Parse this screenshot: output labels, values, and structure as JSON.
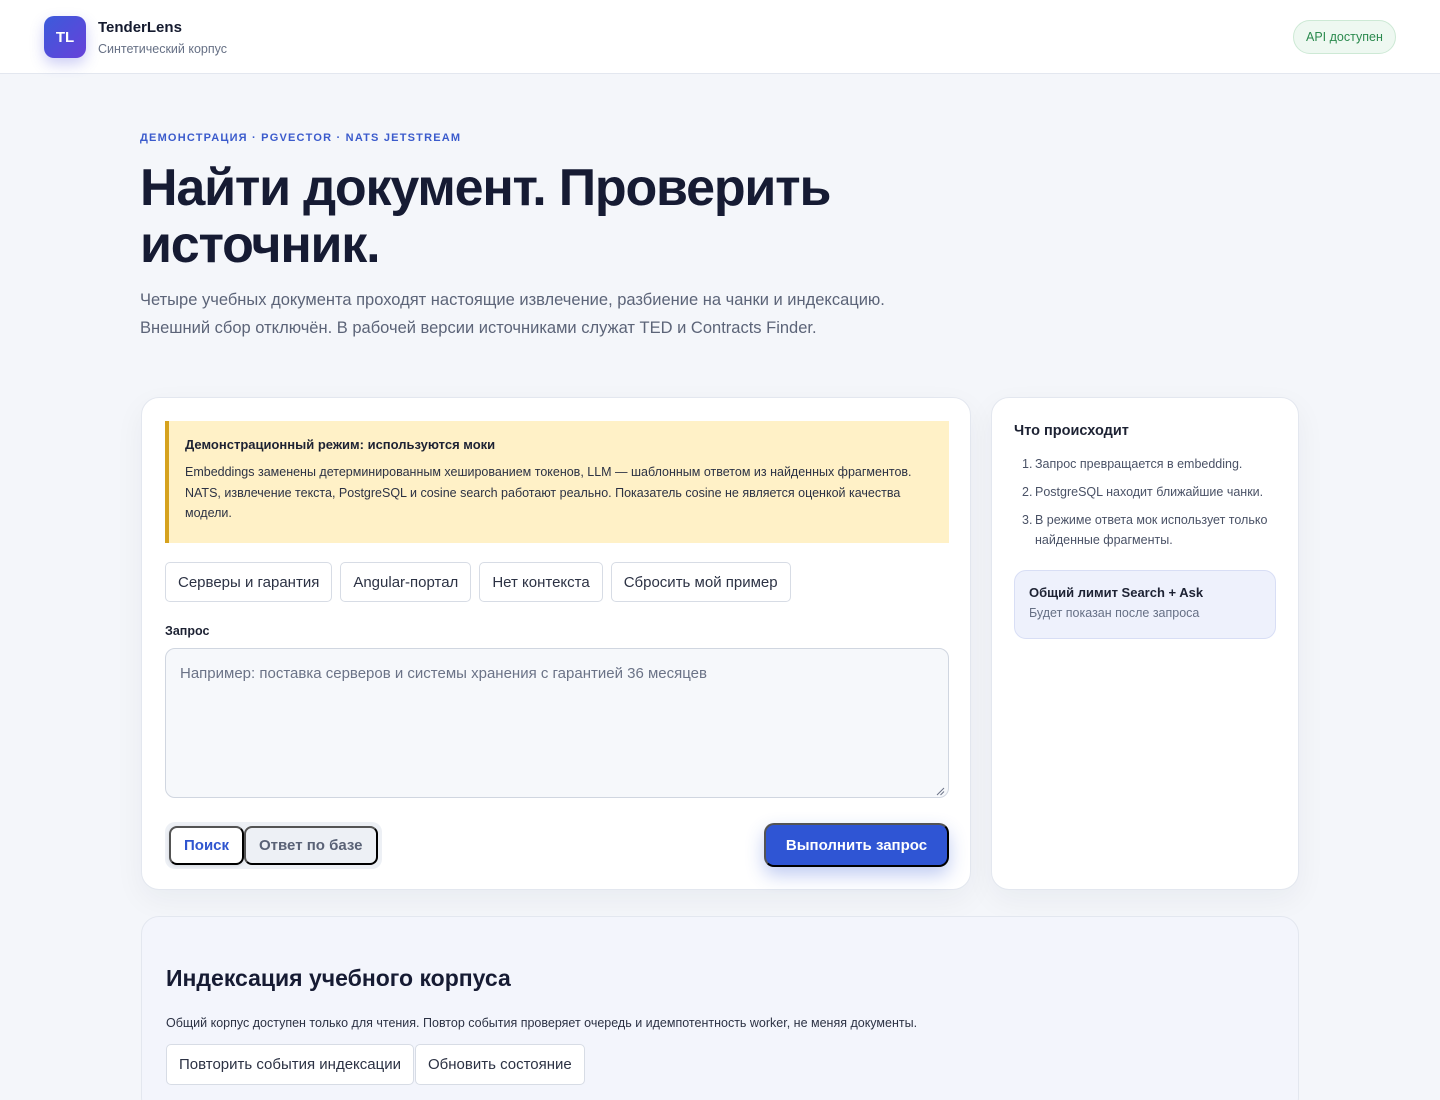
{
  "header": {
    "logo_text": "TL",
    "brand_name": "TenderLens",
    "brand_subtitle": "Синтетический корпус",
    "api_status": "API доступен",
    "api_status_color": "#2b8a4e"
  },
  "hero": {
    "eyebrow": "ДЕМОНСТРАЦИЯ · PGVECTOR · NATS JETSTREAM",
    "title": "Найти документ. Проверить источник.",
    "subtitle": "Четыре учебных документа проходят настоящие извлечение, разбиение на чанки и индексацию. Внешний сбор отключён. В рабочей версии источниками служат TED и Contracts Finder."
  },
  "notice": {
    "title": "Демонстрационный режим: используются моки",
    "text": "Embeddings заменены детерминированным хешированием токенов, LLM — шаблонным ответом из найденных фрагментов. NATS, извлечение текста, PostgreSQL и cosine search работают реально. Показатель cosine не является оценкой качества модели."
  },
  "examples": [
    {
      "label": "Серверы и гарантия"
    },
    {
      "label": "Angular-портал"
    },
    {
      "label": "Нет контекста"
    },
    {
      "label": "Сбросить мой пример"
    }
  ],
  "query": {
    "label": "Запрос",
    "value": "",
    "placeholder": "Например: поставка серверов и системы хранения с гарантией 36 месяцев"
  },
  "modes": {
    "search": "Поиск",
    "answer": "Ответ по базе",
    "selected": "search"
  },
  "run_button": "Выполнить запрос",
  "side": {
    "title": "Что происходит",
    "steps": [
      {
        "num": "1.",
        "text": "Запрос превращается в embedding."
      },
      {
        "num": "2.",
        "text": "PostgreSQL находит ближайшие чанки."
      },
      {
        "num": "3.",
        "text": "В режиме ответа мок использует только найденные фрагменты."
      }
    ],
    "limit_title": "Общий лимит Search + Ask",
    "limit_subtitle": "Будет показан после запроса"
  },
  "indexing": {
    "title": "Индексация учебного корпуса",
    "text": "Общий корпус доступен только для чтения. Повтор события проверяет очередь и идемпотентность worker, не меняя документы.",
    "replay_button": "Повторить события индексации",
    "refresh_button": "Обновить состояние"
  },
  "colors": {
    "accent": "#2f55d4",
    "eyebrow": "#3b5bcc",
    "notice_bg": "#fff1c7",
    "notice_border": "#d6a21e"
  }
}
